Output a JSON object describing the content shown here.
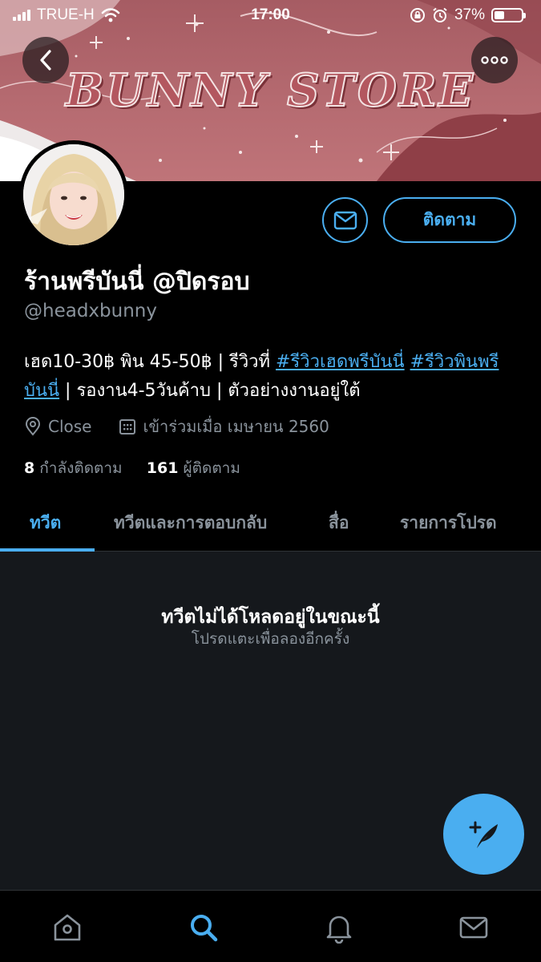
{
  "status_bar": {
    "carrier": "TRUE-H",
    "time": "17:00",
    "battery": "37%",
    "battery_level": 0.37
  },
  "banner": {
    "title": "BUNNY STORE"
  },
  "profile": {
    "display_name": "ร้านพรีบันนี่ @ปิดรอบ",
    "handle": "@headxbunny",
    "follow_button": "ติดตาม",
    "bio": {
      "part1": "เฮด10-30฿ พิน 45-50฿ | รีวิวที่ ",
      "tag1": "#รีวิวเฮดพรีบันนี่",
      "space": " ",
      "tag2": "#รีวิวพินพรีบันนี่",
      "part2": " | รองาน4-5วันค้าบ | ตัวอย่างงานอยู่ใต้"
    },
    "location": "Close",
    "joined": "เข้าร่วมเมื่อ เมษายน 2560",
    "following_count": "8",
    "following_label": "กำลังติดตาม",
    "followers_count": "161",
    "followers_label": "ผู้ติดตาม"
  },
  "tabs": [
    {
      "label": "ทวีต",
      "active": true
    },
    {
      "label": "ทวีตและการตอบกลับ",
      "active": false
    },
    {
      "label": "สื่อ",
      "active": false
    },
    {
      "label": "รายการโปรด",
      "active": false
    }
  ],
  "feed": {
    "error_title": "ทวีตไม่ได้โหลดอยู่ในขณะนี้",
    "error_subtitle": "โปรดแตะเพื่อลองอีกครั้ง"
  },
  "bottom_nav": [
    {
      "icon": "home-icon"
    },
    {
      "icon": "search-icon",
      "active": true
    },
    {
      "icon": "bell-icon"
    },
    {
      "icon": "mail-icon"
    }
  ],
  "colors": {
    "accent": "#4aaef0",
    "background": "#000000",
    "feed_background": "#15181c",
    "secondary_text": "#8a939c",
    "banner": "#b56a70"
  }
}
